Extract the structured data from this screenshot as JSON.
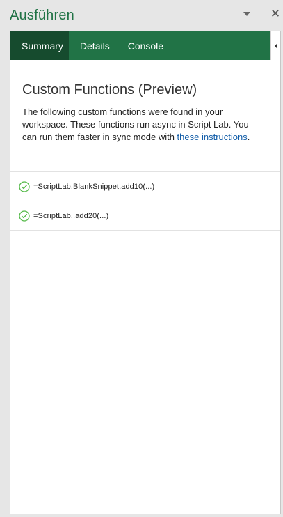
{
  "pane": {
    "title": "Ausführen",
    "dropdown_icon": "triangle-down-icon",
    "close_icon": "close-icon",
    "close_glyph": "✕"
  },
  "tabs": [
    {
      "label": "Summary",
      "active": true
    },
    {
      "label": "Details",
      "active": false
    },
    {
      "label": "Console",
      "active": false
    }
  ],
  "summary": {
    "heading": "Custom Functions (Preview)",
    "description_text": "The following custom functions were found in your workspace. These functions run async in Script Lab. You can run them faster in sync mode with ",
    "link_text": "these instructions",
    "description_end": "."
  },
  "functions": [
    {
      "name": "=ScriptLab.BlankSnippet.add10(...)",
      "status_icon": "check-circle-icon"
    },
    {
      "name": "=ScriptLab..add20(...)",
      "status_icon": "check-circle-icon"
    }
  ],
  "colors": {
    "accent": "#217346",
    "tab_active": "#164b2e",
    "link": "#0f5ba7",
    "check": "#54b948"
  }
}
